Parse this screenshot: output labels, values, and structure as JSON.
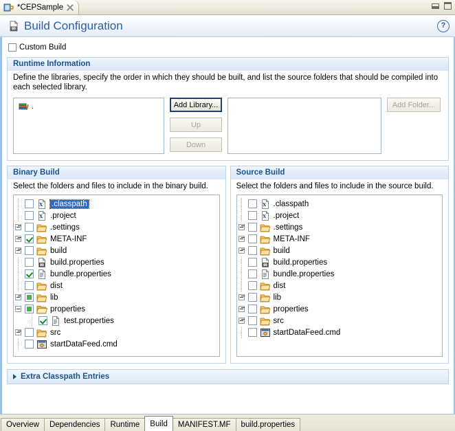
{
  "window": {
    "editor_tab_title": "*CEPSample",
    "editor_tab_icon": "plugin-icon",
    "close_icon": "close-icon",
    "minimize_icon": "minimize-icon",
    "maximize_icon": "maximize-icon"
  },
  "header": {
    "icon": "build-properties-icon",
    "title": "Build Configuration",
    "help_label": "?",
    "help_icon": "help-icon",
    "accent_color": "#2a5daa"
  },
  "custom_build": {
    "label": "Custom Build",
    "checked": false
  },
  "runtime": {
    "title": "Runtime Information",
    "description": "Define the libraries, specify the order in which they should be built, and list the source folders that should be compiled into each selected library.",
    "library_list": [
      {
        "label": ".",
        "icon": "library-books-icon"
      }
    ],
    "folder_list": [],
    "buttons": {
      "add_library": "Add Library...",
      "up": "Up",
      "down": "Down",
      "add_folder": "Add Folder..."
    }
  },
  "binary_build": {
    "title": "Binary Build",
    "description": "Select the folders and files to include in the binary build.",
    "tree": [
      {
        "label": ".classpath",
        "icon": "xml-file-icon",
        "check": "unchecked",
        "expander": "none",
        "indent": 0,
        "selected": true
      },
      {
        "label": ".project",
        "icon": "xml-file-icon",
        "check": "unchecked",
        "expander": "none",
        "indent": 0,
        "selected": false
      },
      {
        "label": ".settings",
        "icon": "folder-icon",
        "check": "unchecked",
        "expander": "plus",
        "indent": 0,
        "selected": false
      },
      {
        "label": "META-INF",
        "icon": "folder-icon",
        "check": "checked",
        "expander": "plus",
        "indent": 0,
        "selected": false
      },
      {
        "label": "build",
        "icon": "folder-icon",
        "check": "unchecked",
        "expander": "plus",
        "indent": 0,
        "selected": false
      },
      {
        "label": "build.properties",
        "icon": "build-properties-icon",
        "check": "unchecked",
        "expander": "none",
        "indent": 0,
        "selected": false
      },
      {
        "label": "bundle.properties",
        "icon": "text-file-icon",
        "check": "checked",
        "expander": "none",
        "indent": 0,
        "selected": false
      },
      {
        "label": "dist",
        "icon": "folder-icon",
        "check": "unchecked",
        "expander": "none",
        "indent": 0,
        "selected": false
      },
      {
        "label": "lib",
        "icon": "folder-icon",
        "check": "partial",
        "expander": "plus",
        "indent": 0,
        "selected": false
      },
      {
        "label": "properties",
        "icon": "folder-open-icon",
        "check": "partial",
        "expander": "minus",
        "indent": 0,
        "selected": false
      },
      {
        "label": "test.properties",
        "icon": "text-file-icon",
        "check": "checked",
        "expander": "none",
        "indent": 1,
        "selected": false
      },
      {
        "label": "src",
        "icon": "folder-icon",
        "check": "unchecked",
        "expander": "plus",
        "indent": 0,
        "selected": false
      },
      {
        "label": "startDataFeed.cmd",
        "icon": "console-file-icon",
        "check": "unchecked",
        "expander": "none",
        "indent": 0,
        "selected": false
      }
    ]
  },
  "source_build": {
    "title": "Source Build",
    "description": "Select the folders and files to include in the source build.",
    "tree": [
      {
        "label": ".classpath",
        "icon": "xml-file-icon",
        "check": "unchecked",
        "expander": "none",
        "indent": 0,
        "selected": false
      },
      {
        "label": ".project",
        "icon": "xml-file-icon",
        "check": "unchecked",
        "expander": "none",
        "indent": 0,
        "selected": false
      },
      {
        "label": ".settings",
        "icon": "folder-icon",
        "check": "unchecked",
        "expander": "plus",
        "indent": 0,
        "selected": false
      },
      {
        "label": "META-INF",
        "icon": "folder-icon",
        "check": "unchecked",
        "expander": "plus",
        "indent": 0,
        "selected": false
      },
      {
        "label": "build",
        "icon": "folder-icon",
        "check": "unchecked",
        "expander": "plus",
        "indent": 0,
        "selected": false
      },
      {
        "label": "build.properties",
        "icon": "build-properties-icon",
        "check": "unchecked",
        "expander": "none",
        "indent": 0,
        "selected": false
      },
      {
        "label": "bundle.properties",
        "icon": "text-file-icon",
        "check": "unchecked",
        "expander": "none",
        "indent": 0,
        "selected": false
      },
      {
        "label": "dist",
        "icon": "folder-icon",
        "check": "unchecked",
        "expander": "none",
        "indent": 0,
        "selected": false
      },
      {
        "label": "lib",
        "icon": "folder-icon",
        "check": "unchecked",
        "expander": "plus",
        "indent": 0,
        "selected": false
      },
      {
        "label": "properties",
        "icon": "folder-icon",
        "check": "unchecked",
        "expander": "plus",
        "indent": 0,
        "selected": false
      },
      {
        "label": "src",
        "icon": "folder-icon",
        "check": "unchecked",
        "expander": "plus",
        "indent": 0,
        "selected": false
      },
      {
        "label": "startDataFeed.cmd",
        "icon": "console-file-icon",
        "check": "unchecked",
        "expander": "none",
        "indent": 0,
        "selected": false
      }
    ]
  },
  "extra_classpath": {
    "title": "Extra Classpath Entries",
    "expanded": false,
    "arrow_icon": "triangle-right-icon"
  },
  "bottom_tabs": [
    {
      "label": "Overview",
      "active": false
    },
    {
      "label": "Dependencies",
      "active": false
    },
    {
      "label": "Runtime",
      "active": false
    },
    {
      "label": "Build",
      "active": true
    },
    {
      "label": "MANIFEST.MF",
      "active": false
    },
    {
      "label": "build.properties",
      "active": false
    }
  ]
}
